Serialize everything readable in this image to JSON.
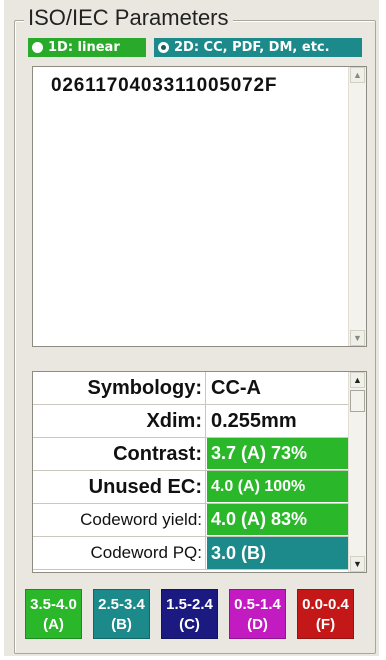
{
  "group_title": "ISO/IEC Parameters",
  "modes": [
    {
      "label": "1D: linear",
      "selected": false,
      "color": "#2aaa2a"
    },
    {
      "label": "2D: CC, PDF, DM, etc.",
      "selected": true,
      "color": "#1c8a8a"
    }
  ],
  "decoded_data": "0261170403311005072F",
  "parameters": [
    {
      "label": "Symbology:",
      "value": "CC-A",
      "style": "plain"
    },
    {
      "label": "Xdim:",
      "value": "0.255mm",
      "style": "plain"
    },
    {
      "label": "Contrast:",
      "value": "3.7 (A) 73%",
      "style": "green"
    },
    {
      "label": "Unused EC:",
      "value": "4.0 (A) 100%",
      "style": "green"
    },
    {
      "label": "Codeword yield:",
      "value": "4.0 (A) 83%",
      "style": "green"
    },
    {
      "label": "Codeword PQ:",
      "value": "3.0 (B)",
      "style": "teal"
    }
  ],
  "scroll_arrows": {
    "up": "▲",
    "down": "▼"
  },
  "grade_legend": [
    {
      "range": "3.5-4.0",
      "grade": "(A)",
      "color": "#2ab82a"
    },
    {
      "range": "2.5-3.4",
      "grade": "(B)",
      "color": "#1c8a8a"
    },
    {
      "range": "1.5-2.4",
      "grade": "(C)",
      "color": "#1a1a80"
    },
    {
      "range": "0.5-1.4",
      "grade": "(D)",
      "color": "#c21bc2"
    },
    {
      "range": "0.0-0.4",
      "grade": "(F)",
      "color": "#c41818"
    }
  ]
}
